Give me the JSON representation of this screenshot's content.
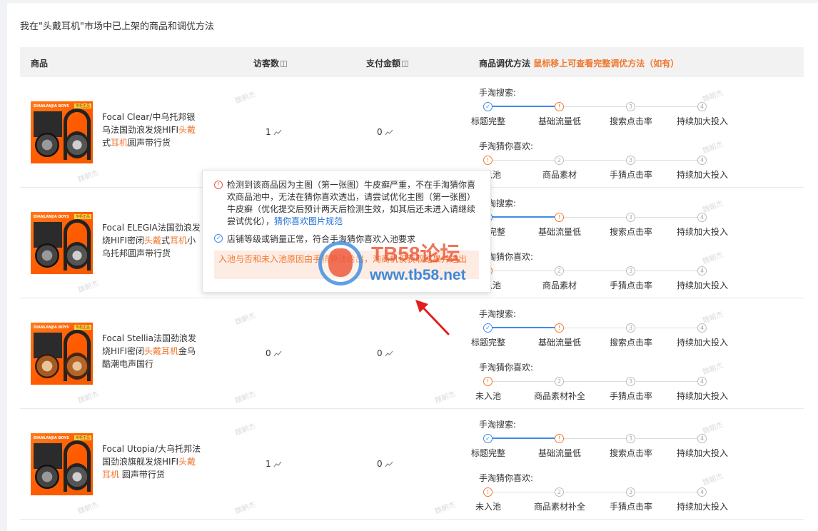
{
  "panel_title": "我在\"头戴耳机\"市场中已上架的商品和调优方法",
  "header": {
    "product": "商品",
    "visitors": "访客数",
    "payment": "支付金额",
    "optimize": "商品调优方法",
    "optimize_hint": "鼠标移上可查看完整调优方法（如有）"
  },
  "products": [
    {
      "name_pre": "Focal Clear/中乌托邦银乌法国劲浪发烧HIFI",
      "name_hl1": "头戴",
      "name_mid": "式",
      "name_hl2": "耳机",
      "name_post": "圆声带行货",
      "visitors": "1",
      "payment": "0",
      "search_label": "手淘搜索:",
      "search_steps": [
        "标题完整",
        "基础流量低",
        "搜索点击率",
        "持续加大投入"
      ],
      "guess_label": "手淘猜你喜欢:",
      "guess_steps": [
        "未入池",
        "商品素材",
        "手猜点击率",
        "持续加大投入"
      ]
    },
    {
      "name_pre": "Focal ELEGIA法国劲浪发烧HIFI密闭",
      "name_hl1": "头戴",
      "name_mid": "式",
      "name_hl2": "耳机",
      "name_post": "小乌托邦圆声带行货",
      "visitors": "",
      "payment": "",
      "search_label": "手淘搜索:",
      "search_steps": [
        "标题完整",
        "基础流量低",
        "搜索点击率",
        "持续加大投入"
      ],
      "guess_label": "手淘猜你喜欢:",
      "guess_steps": [
        "未入池",
        "商品素材",
        "手猜点击率",
        "持续加大投入"
      ]
    },
    {
      "name_pre": "Focal Stellia法国劲浪发烧HIFI密闭",
      "name_hl1": "头戴",
      "name_mid": "",
      "name_hl2": "耳机",
      "name_post": "金乌酷潮电声国行",
      "visitors": "0",
      "payment": "0",
      "search_label": "手淘搜索:",
      "search_steps": [
        "标题完整",
        "基础流量低",
        "搜索点击率",
        "持续加大投入"
      ],
      "guess_label": "手淘猜你喜欢:",
      "guess_steps": [
        "未入池",
        "商品素材补全",
        "手猜点击率",
        "持续加大投入"
      ]
    },
    {
      "name_pre": "Focal Utopia/大乌托邦法国劲浪旗舰发烧HIFI",
      "name_hl1": "头戴",
      "name_mid": "",
      "name_hl2": "耳机",
      "name_post": " 圆声带行货",
      "visitors": "1",
      "payment": "0",
      "search_label": "手淘搜索:",
      "search_steps": [
        "标题完整",
        "基础流量低",
        "搜索点击率",
        "持续加大投入"
      ],
      "guess_label": "手淘猜你喜欢:",
      "guess_steps": [
        "未入池",
        "商品素材补全",
        "手猜点击率",
        "持续加大投入"
      ]
    }
  ],
  "step_numbers": [
    "1",
    "2",
    "3",
    "4"
  ],
  "thumb": {
    "brand": "DIANLANJIA BOYS",
    "tag": "专柜正品"
  },
  "popup": {
    "warn_text": "检测到该商品因为主图（第一张图）牛皮癣严重，不在手淘猜你喜欢商品池中，无法在猜你喜欢透出，请尝试优化主图（第一张图）牛皮癣（优化提交后预计两天后检测生效，如其后还未进入请继续尝试优化），",
    "warn_link": "猜你喜欢图片规范",
    "ok_text": "店铺等级或销量正常，符合手淘猜你喜欢入池要求",
    "note": "入池与否和未入池原因由手猜算法给出，淘商机仅获取结果并透出"
  },
  "watermark": "魏朝杰",
  "logo": {
    "line1": "TB58论坛",
    "line2": "www.tb58.net"
  },
  "colors": {
    "accent": "#f07830",
    "blue": "#3f8be8",
    "link": "#1f6fd6"
  }
}
